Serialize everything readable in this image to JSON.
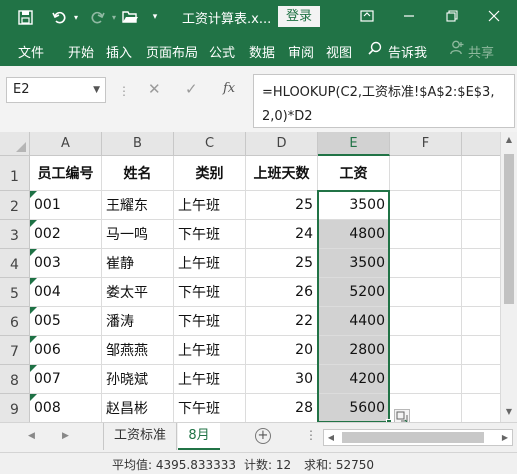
{
  "titlebar": {
    "save_icon": "save-icon",
    "undo_icon": "undo-icon",
    "redo_icon": "redo-icon",
    "open_icon": "folder-open-icon",
    "customize_icon": "customize-quick-access-icon",
    "title": "工资计算表.x...",
    "login": "登录"
  },
  "ribbon": {
    "tabs": [
      "文件",
      "开始",
      "插入",
      "页面布局",
      "公式",
      "数据",
      "审阅",
      "视图"
    ],
    "tell_me": "告诉我",
    "share": "共享"
  },
  "formula": {
    "namebox": "E2",
    "content": "=HLOOKUP(C2,工资标准!$A$2:$E$3,2,0)*D2"
  },
  "grid": {
    "columns": [
      "A",
      "B",
      "C",
      "D",
      "E",
      "F"
    ],
    "rows": [
      "1",
      "2",
      "3",
      "4",
      "5",
      "6",
      "7",
      "8",
      "9"
    ],
    "header": [
      "员工编号",
      "姓名",
      "类别",
      "上班天数",
      "工资"
    ],
    "data": [
      [
        "001",
        "王耀东",
        "上午班",
        "25",
        "3500"
      ],
      [
        "002",
        "马一鸣",
        "下午班",
        "24",
        "4800"
      ],
      [
        "003",
        "崔静",
        "上午班",
        "25",
        "3500"
      ],
      [
        "004",
        "娄太平",
        "下午班",
        "26",
        "5200"
      ],
      [
        "005",
        "潘涛",
        "下午班",
        "22",
        "4400"
      ],
      [
        "006",
        "邹燕燕",
        "上午班",
        "20",
        "2800"
      ],
      [
        "007",
        "孙晓斌",
        "上午班",
        "30",
        "4200"
      ],
      [
        "008",
        "赵昌彬",
        "下午班",
        "28",
        "5600"
      ]
    ]
  },
  "sheets": {
    "tabs": [
      "工资标准",
      "8月"
    ],
    "active": "8月"
  },
  "status": {
    "average": "平均值: 4395.833333",
    "count": "计数: 12",
    "sum": "求和: 52750"
  }
}
